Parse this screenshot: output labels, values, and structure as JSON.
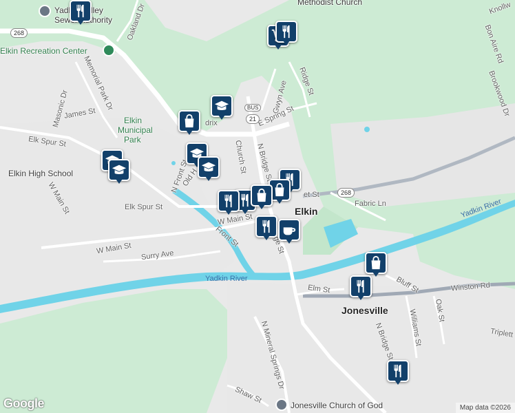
{
  "map": {
    "places": {
      "town_elkin": "Elkin",
      "town_jonesville": "Jonesville",
      "park": [
        "Elkin",
        "Municipal",
        "Park"
      ],
      "rec_center": "Elkin Recreation Center",
      "high_school": "Elkin High School",
      "church_top": "Methodist Church",
      "church_bottom": "Jonesville Church of God",
      "authority": [
        "Yadkin Valley",
        "Sewer Authority"
      ]
    },
    "river_labels": [
      "Yadkin River",
      "Yadkin River"
    ],
    "streets": {
      "oakland_dr": "Oakland Dr",
      "memorial_park_dr": "Memorial Park Dr",
      "masonic_dr": "Masonic Dr",
      "james_st": "James St",
      "elk_spur_st_w": "Elk Spur St",
      "elk_spur_st_mid": "Elk Spur St",
      "w_main_st_nw": "W Main St",
      "w_main_st": "W Main St",
      "w_main_st_c": "W Main St",
      "surry_ave": "Surry Ave",
      "front_st": "Front St",
      "n_front_st": "N Front St",
      "old_hendrix": "Old H",
      "hendrix": "drix",
      "church_st": "Church St",
      "n_bridge_st": "N Bridge St",
      "gwyn_ave": "Gwyn Ave",
      "e_spring_st": "E Spring St",
      "ridge_st": "Ridge St",
      "market_st": "et St",
      "fabric_ln": "Fabric Ln",
      "bon_aire_rd": "Bon Aire Rd",
      "brookwood_dr": "Brookwood Dr",
      "knollwood": "Knollw",
      "bridge_st_s": "ge St",
      "elm_st": "Elm St",
      "bluff_st": "Bluff St",
      "winston_rd": "Winston Rd",
      "williams_st": "Williams St",
      "oak_st": "Oak St",
      "triplett": "Triplett",
      "n_bridge_st_j": "N Bridge St",
      "n_mineral_springs_dr": "N Mineral Springs Dr",
      "shaw_st": "Shaw St"
    },
    "shields": [
      "268",
      "268",
      "21",
      "BUS"
    ],
    "attribution": "Map data ©2026",
    "logo": "Google"
  },
  "markers": [
    {
      "type": "restaurant",
      "icon": "fork-knife-icon"
    },
    {
      "type": "shopping",
      "icon": "shopping-cart-icon"
    },
    {
      "type": "restaurant",
      "icon": "fork-knife-icon"
    },
    {
      "type": "school",
      "icon": "graduation-cap-icon"
    },
    {
      "type": "store",
      "icon": "shopping-bag-icon"
    },
    {
      "type": "school",
      "icon": "graduation-cap-icon"
    },
    {
      "type": "school",
      "icon": "graduation-cap-icon"
    },
    {
      "type": "school",
      "icon": "graduation-cap-icon"
    },
    {
      "type": "school",
      "icon": "graduation-cap-icon"
    },
    {
      "type": "restaurant",
      "icon": "fork-knife-icon"
    },
    {
      "type": "store",
      "icon": "shopping-bag-icon"
    },
    {
      "type": "restaurant",
      "icon": "fork-knife-icon"
    },
    {
      "type": "cafe",
      "icon": "coffee-cup-icon"
    },
    {
      "type": "store",
      "icon": "shopping-bag-icon"
    },
    {
      "type": "restaurant",
      "icon": "fork-knife-icon"
    },
    {
      "type": "restaurant",
      "icon": "fork-knife-icon"
    }
  ],
  "colors": {
    "land": "#eaeaea",
    "park": "#c8ebd2",
    "water": "#6fd2e8",
    "road": "#ffffff",
    "highway": "#9aa5b2",
    "marker": "#12406a"
  }
}
